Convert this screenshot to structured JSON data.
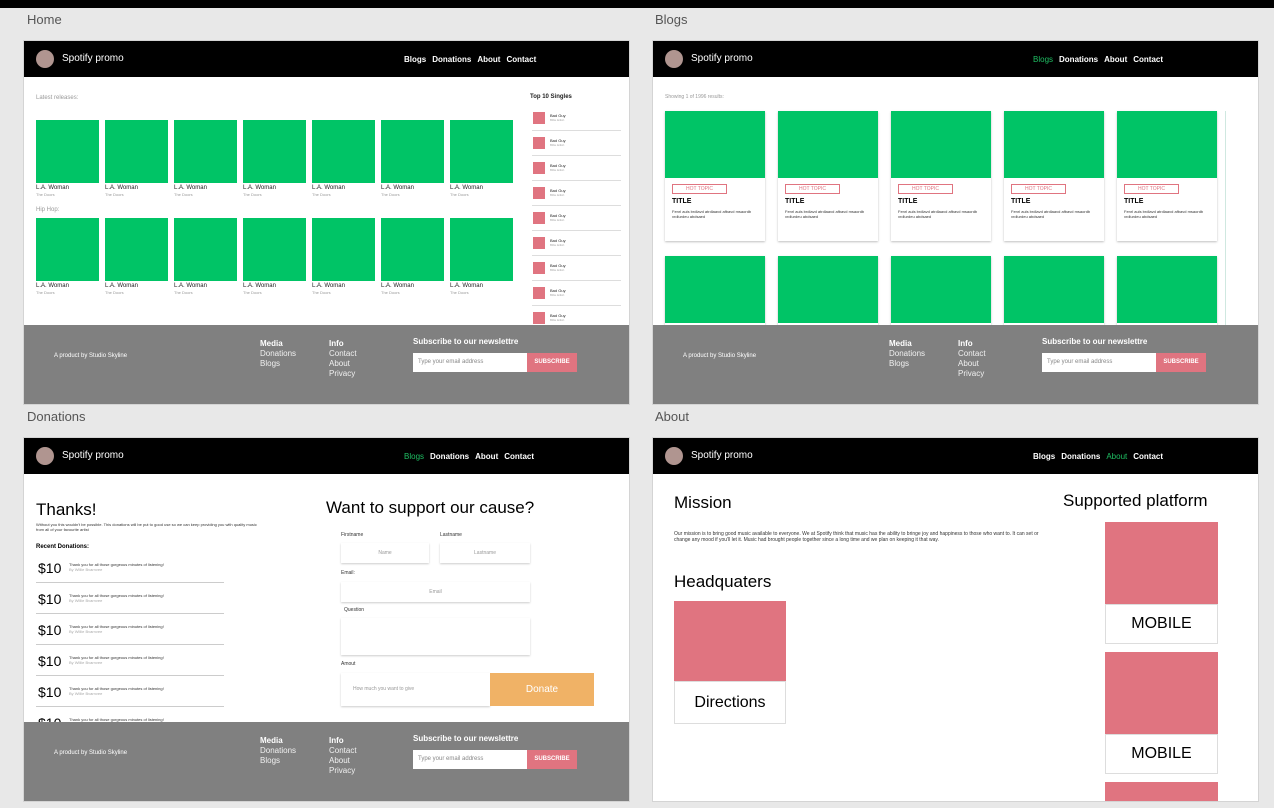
{
  "frames": {
    "home": "Home",
    "blogs": "Blogs",
    "donations": "Donations",
    "about": "About"
  },
  "nav": {
    "brand": "Spotify promo",
    "links": [
      "Blogs",
      "Donations",
      "About",
      "Contact"
    ]
  },
  "footer": {
    "credit": "A product by Studio Skyline",
    "media_title": "Media",
    "media_items": [
      "Donations",
      "Blogs"
    ],
    "info_title": "Info",
    "info_items": [
      "Contact",
      "About",
      "Privacy"
    ],
    "newsletter_title": "Subscribe to our newslettre",
    "email_placeholder": "Type your email address",
    "subscribe_label": "SUBSCRIBE"
  },
  "home": {
    "latest_label": "Latest releases:",
    "hiphop_label": "Hip Hop:",
    "album_title": "L.A. Woman",
    "album_artist": "The Doors",
    "top_title": "Top 10 Singles",
    "single_title": "Bad Guy",
    "single_artist": "Billie Eilish"
  },
  "blogs": {
    "showing": "Showing 1 of 1996 results:",
    "tag": "HOT TOPIC",
    "card_title": "TITLE",
    "card_desc": "Fenrl auls brdlavd atrdlaavd afbavd msaordb xrdlurdeu abdsaed"
  },
  "donations": {
    "thanks": "Thanks!",
    "paragraph": "Without you this wouldn't be possible. This donations will be put to good use so we can keep providing you with quality music from all of your favourite artist",
    "recent": "Recent Donations:",
    "amount": "$10",
    "message": "Thank you for all those gorgeous minutes of listening!",
    "by": "By Willie Bvarnvee",
    "want": "Want to support our cause?",
    "firstname_label": "Firstname",
    "lastname_label": "Lastname",
    "firstname_placeholder": "Name",
    "lastname_placeholder": "Lastname",
    "email_label": "Email:",
    "email_placeholder": "Email",
    "question_label": "Question",
    "amount_label": "Amout",
    "amount_placeholder": "How much you want to give",
    "donate": "Donate"
  },
  "about": {
    "mission_title": "Mission",
    "mission_text": "Our mission is to bring good music available to everyone. We at Spotify think that music has the ability to bringe joy and happiness to those who want to. It can set or change any mood if you'll let it. Music had brought people together since a long time and we plan on keeping it that way.",
    "hq_title": "Headquaters",
    "directions": "Directions",
    "platform_title": "Supported platform",
    "mobile": "MOBILE"
  },
  "colors": {
    "green": "#00c466",
    "pink": "#e07480",
    "orange": "#f0b266",
    "footer_gray": "#808080",
    "active_link": "#1fbf63"
  }
}
